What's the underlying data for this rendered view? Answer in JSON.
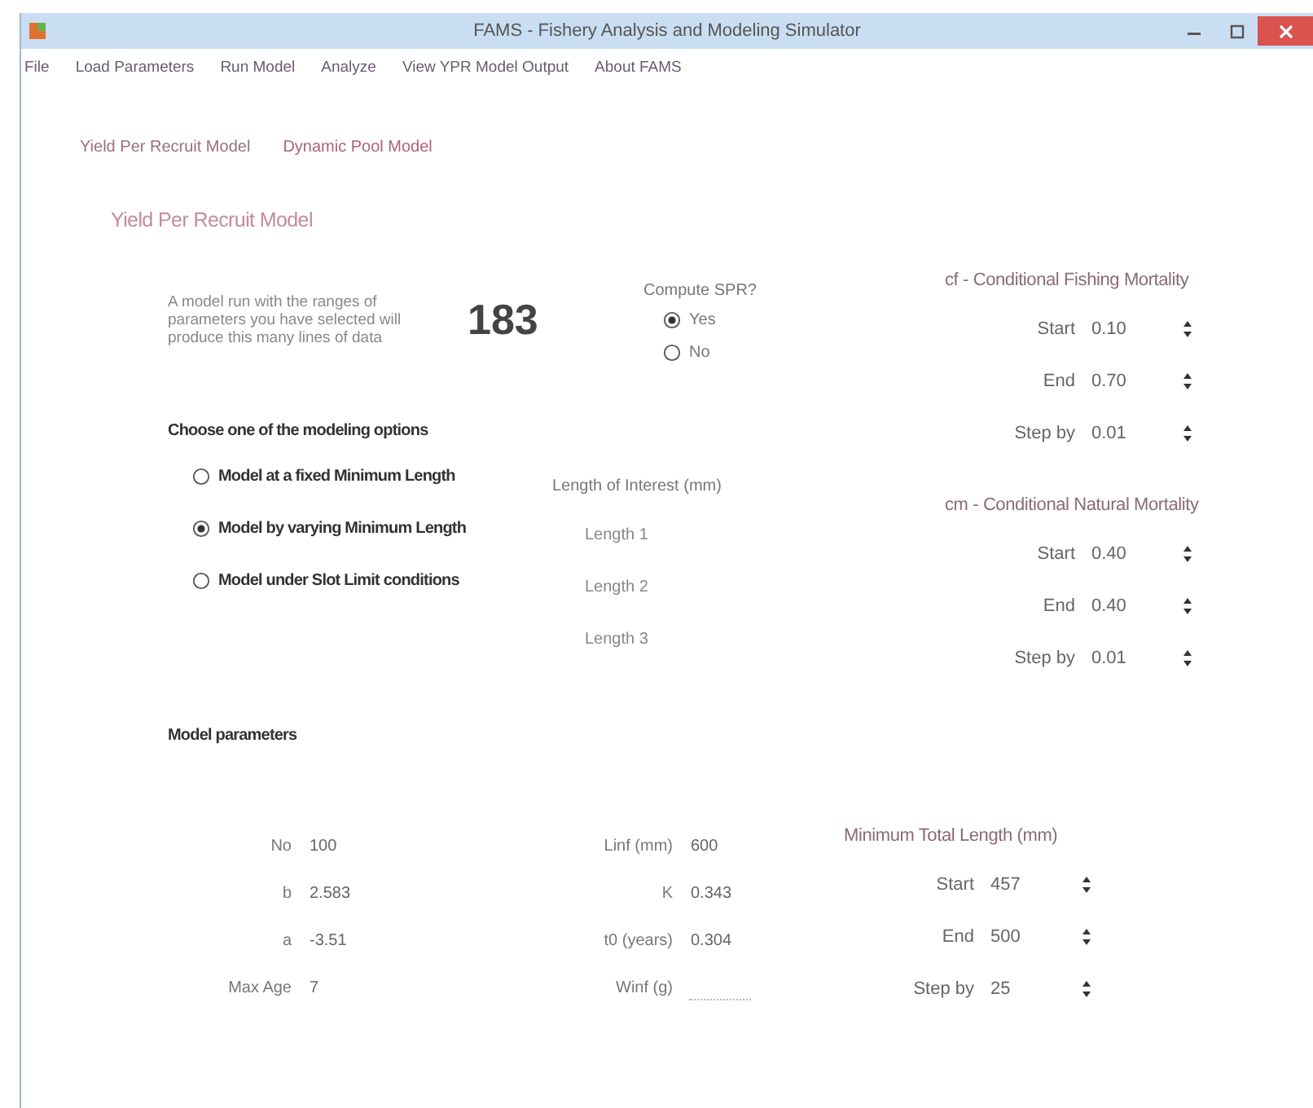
{
  "window": {
    "title": "FAMS - Fishery Analysis and Modeling Simulator"
  },
  "menu": [
    "File",
    "Load Parameters",
    "Run Model",
    "Analyze",
    "View YPR Model Output",
    "About FAMS"
  ],
  "tabs": [
    {
      "label": "Yield Per Recruit Model",
      "selected": true
    },
    {
      "label": "Dynamic Pool Model",
      "selected": false
    }
  ],
  "page_heading": "Yield Per Recruit Model",
  "run_count": {
    "description": "A model run with the ranges of parameters you have selected will produce this many lines of data",
    "value": "183"
  },
  "compute_spr": {
    "label": "Compute SPR?",
    "options": [
      {
        "label": "Yes",
        "selected": true
      },
      {
        "label": "No",
        "selected": false
      }
    ]
  },
  "modeling_options": {
    "label": "Choose one of the modeling options",
    "options": [
      {
        "label": "Model at a fixed Minimum Length",
        "selected": false
      },
      {
        "label": "Model by varying Minimum Length",
        "selected": true
      },
      {
        "label": "Model under Slot Limit conditions",
        "selected": false
      }
    ]
  },
  "length_of_interest": {
    "label": "Length of Interest (mm)",
    "items": [
      "Length 1",
      "Length 2",
      "Length 3"
    ]
  },
  "fishing_mortality": {
    "label": "cf - Conditional Fishing Mortality",
    "fields": [
      {
        "label": "Start",
        "value": "0.10"
      },
      {
        "label": "End",
        "value": "0.70"
      },
      {
        "label": "Step by",
        "value": "0.01"
      }
    ]
  },
  "natural_mortality": {
    "label": "cm - Conditional Natural Mortality",
    "fields": [
      {
        "label": "Start",
        "value": "0.40"
      },
      {
        "label": "End",
        "value": "0.40"
      },
      {
        "label": "Step by",
        "value": "0.01"
      }
    ]
  },
  "model_parameters": {
    "label": "Model parameters",
    "fields": [
      {
        "label": "No",
        "value": "100"
      },
      {
        "label": "b",
        "value": "2.583"
      },
      {
        "label": "a",
        "value": "-3.51"
      },
      {
        "label": "Max Age",
        "value": "7"
      },
      {
        "label": "Linf (mm)",
        "value": "600"
      },
      {
        "label": "K",
        "value": "0.343"
      },
      {
        "label": "t0 (years)",
        "value": "0.304"
      },
      {
        "label": "Winf (g)"
      }
    ]
  },
  "min_total_length": {
    "label": "Minimum Total Length (mm)",
    "fields": [
      {
        "label": "Start",
        "value": "457"
      },
      {
        "label": "End",
        "value": "500"
      },
      {
        "label": "Step by",
        "value": "25"
      }
    ]
  }
}
